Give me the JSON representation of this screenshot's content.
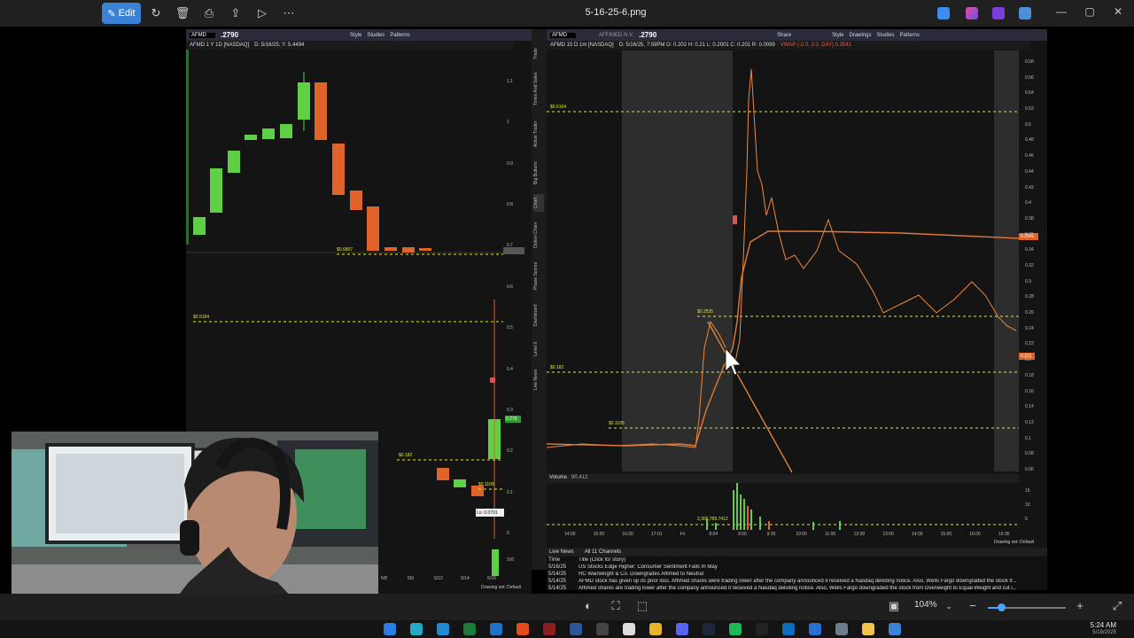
{
  "viewer": {
    "edit_label": "Edit",
    "file_title": "5-16-25-6.png",
    "zoom": "104%",
    "toolbar_icons": [
      "rotate-icon",
      "delete-icon",
      "print-icon",
      "share-icon",
      "slideshow-icon",
      "more-icon"
    ]
  },
  "left_chart": {
    "symbol": "AFMD",
    "price": ".2790",
    "menu": [
      "Style",
      "Studies",
      "Patterns"
    ],
    "desc": "AFMD 1 Y 1D [NASDAQ]",
    "meta": "D: 5/16/25, Y: 5.4494",
    "levels": [
      {
        "label": "$0.6807"
      },
      {
        "label": "$0.5164"
      },
      {
        "label": "$0.182"
      },
      {
        "label": "$0.1105"
      }
    ],
    "low_label": "Lo: 0.0701",
    "price_tag": "0.279",
    "drawing_set": "Drawing set: Default",
    "y_ticks": [
      "1.1",
      "1",
      "0.9",
      "0.8",
      "0.7",
      "0.6",
      "0.5",
      "0.4",
      "0.3",
      "0.2",
      "0.1",
      "0"
    ],
    "x_ticks": [
      "5/8",
      "5/9",
      "5/12",
      "5/14",
      "5/16"
    ],
    "vol_tick": "500"
  },
  "right_chart": {
    "symbol": "AFMD",
    "company": "AFFIMED N.V.",
    "price": ".2790",
    "menu": [
      "Share",
      "Style",
      "Drawings",
      "Studies",
      "Patterns"
    ],
    "desc": "AFMD 15 D 1m [NASDAQ]",
    "meta": "D: 5/16/25, 7:59PM  O: 0.202  H: 0.21  L: 0.2001  C: 0.201  R: 0.0099",
    "vwap": "VWAP (-2.0, 2.0, DAY)  0.3541",
    "levels": [
      {
        "label": "$0.5164"
      },
      {
        "label": "$0.2535"
      },
      {
        "label": "$0.182"
      },
      {
        "label": "$0.1105"
      }
    ],
    "y_ticks": [
      "0.58",
      "0.56",
      "0.54",
      "0.52",
      "0.5",
      "0.48",
      "0.46",
      "0.44",
      "0.42",
      "0.4",
      "0.38",
      "0.36",
      "0.34",
      "0.32",
      "0.3",
      "0.28",
      "0.26",
      "0.24",
      "0.22",
      "0.2",
      "0.18",
      "0.16",
      "0.14",
      "0.12",
      "0.1",
      "0.08",
      "0.06"
    ],
    "vwap_tag": "0.3541",
    "price_tag": "0.201",
    "volume_label": "Volume",
    "volume_value": "90,412",
    "volume_level": "2,306,789.7412",
    "vol_ticks": [
      "15",
      "10",
      "5"
    ],
    "x_ticks": [
      "14:00",
      "15:00",
      "16:00",
      "17:01",
      "Fri",
      "8:04",
      "9:00",
      "9:30",
      "10:00",
      "11:00",
      "12:00",
      "13:00",
      "14:00",
      "15:00",
      "16:00",
      "16:35"
    ],
    "drawing_set": "Drawing set: Default"
  },
  "side_tabs": [
    "Trade",
    "Times And Sales",
    "Active Trader",
    "Big Buttons",
    "Chart",
    "Option Chain",
    "Phase Scores",
    "Dashboard",
    "Level II",
    "Live News"
  ],
  "news": {
    "tabs": [
      "Live News",
      "All 11 Channels"
    ],
    "col_time": "Time",
    "col_title": "Title (Click for story)",
    "rows": [
      {
        "time": "5/16/25",
        "title": "US Stocks Edge Higher; Consumer Sentiment Falls In May"
      },
      {
        "time": "5/14/25",
        "title": "HC Wainwright & Co. Downgrades Affimed to Neutral"
      },
      {
        "time": "5/14/25",
        "title": "AFMD stock has given up its prior loss. Affimed shares were trading lower after the company announced it received a Nasdaq delisting notice. Also, Wells Fargo downgraded the stock fr..."
      },
      {
        "time": "5/14/25",
        "title": "Affimed shares are trading lower after the company announced it received a Nasdaq delisting notice. Also, Wells Fargo downgraded the stock from Overweight to Equal-Weight and cut i..."
      }
    ]
  },
  "taskbar": {
    "time": "5:24 AM",
    "date": "5/19/2025"
  }
}
